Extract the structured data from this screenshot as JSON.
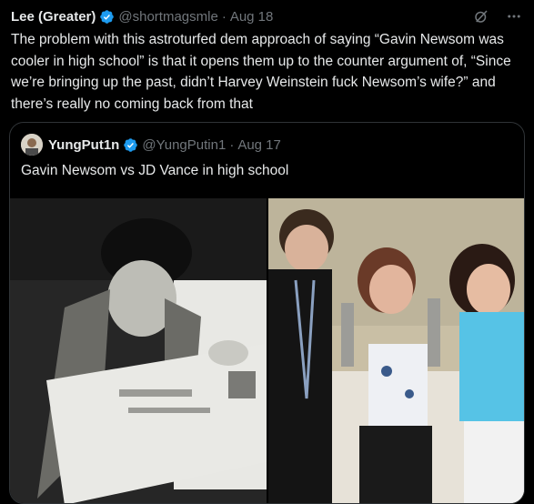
{
  "tweet": {
    "author_name": "Lee (Greater)",
    "handle": "@shortmagsmle",
    "separator": "·",
    "date": "Aug 18",
    "text": "The problem with this astroturfed dem approach of saying “Gavin Newsom was cooler in high school” is that it opens them up to the counter argument of, “Since we’re bringing up the past, didn’t Harvey Weinstein fuck Newsom’s wife?” and there’s really no coming back from that"
  },
  "quoted_tweet": {
    "author_name": "YungPut1n",
    "handle": "@YungPutin1",
    "separator": "·",
    "date": "Aug 17",
    "text": "Gavin Newsom vs JD Vance in high school"
  },
  "icons": {
    "verified": "verified-badge-icon",
    "grok": "grok-icon",
    "more": "more-options-icon"
  },
  "colors": {
    "background": "#000000",
    "text": "#e7e9ea",
    "muted": "#71767b",
    "verified": "#1d9bf0",
    "border": "#2f3336"
  }
}
